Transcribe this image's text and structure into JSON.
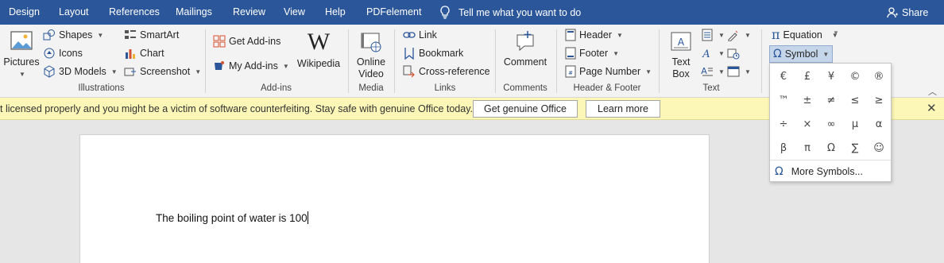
{
  "tabs": [
    "Design",
    "Layout",
    "References",
    "Mailings",
    "Review",
    "View",
    "Help",
    "PDFelement"
  ],
  "tell_me": "Tell me what you want to do",
  "share": "Share",
  "illustrations": {
    "pictures": "Pictures",
    "shapes": "Shapes",
    "icons": "Icons",
    "models3d": "3D Models",
    "smartart": "SmartArt",
    "chart": "Chart",
    "screenshot": "Screenshot",
    "label": "Illustrations"
  },
  "addins": {
    "get": "Get Add-ins",
    "my": "My Add-ins",
    "wikipedia": "Wikipedia",
    "label": "Add-ins"
  },
  "media": {
    "online_video_1": "Online",
    "online_video_2": "Video",
    "label": "Media"
  },
  "links": {
    "link": "Link",
    "bookmark": "Bookmark",
    "crossref": "Cross-reference",
    "label": "Links"
  },
  "comments": {
    "comment": "Comment",
    "label": "Comments"
  },
  "headerfooter": {
    "header": "Header",
    "footer": "Footer",
    "page_number": "Page Number",
    "label": "Header & Footer"
  },
  "text_group": {
    "textbox_1": "Text",
    "textbox_2": "Box",
    "label": "Text"
  },
  "symbols": {
    "equation": "Equation",
    "symbol": "Symbol",
    "grid": [
      "€",
      "£",
      "¥",
      "©",
      "®",
      "™",
      "±",
      "≠",
      "≤",
      "≥",
      "÷",
      "×",
      "∞",
      "µ",
      "α",
      "β",
      "π",
      "Ω",
      "∑",
      "☺"
    ],
    "more": "More Symbols..."
  },
  "notice": {
    "message": "t licensed properly and you might be a victim of software counterfeiting. Stay safe with genuine Office today.",
    "genuine": "Get genuine Office",
    "learn": "Learn more"
  },
  "document": {
    "text": "The boiling point of water is 100"
  },
  "colors": {
    "brand": "#2b579a",
    "notice_bg": "#fcf7b6",
    "selected": "#c5d5ea"
  }
}
